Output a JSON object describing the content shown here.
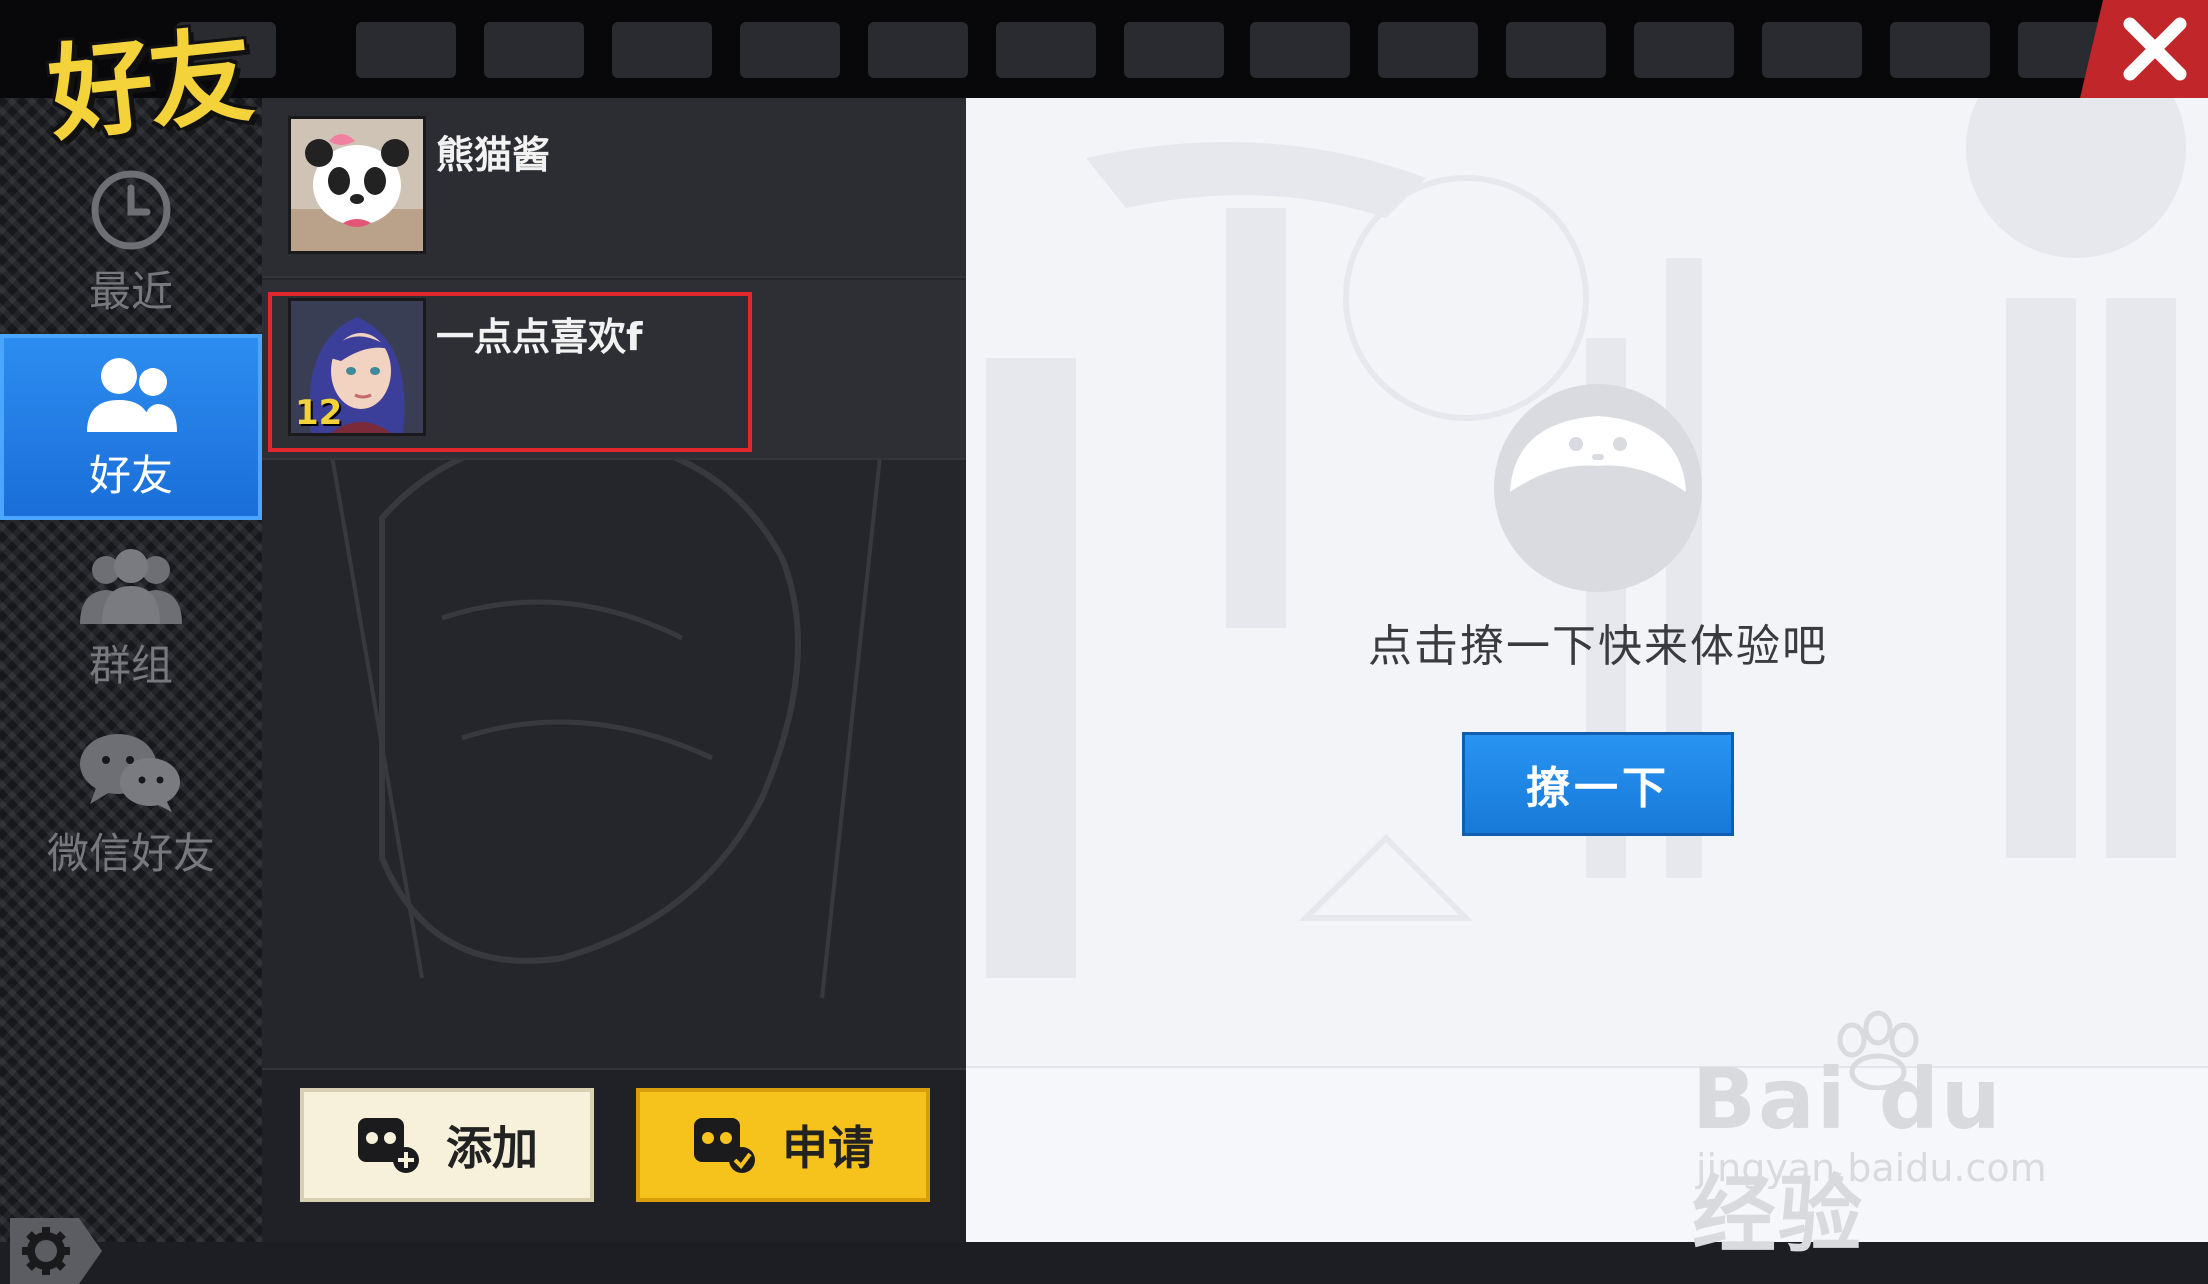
{
  "header": {
    "title": "好友",
    "close_icon": "close-icon",
    "accent_color": "#c0262a",
    "title_color": "#f4d23a"
  },
  "sidebar": {
    "items": [
      {
        "label": "最近",
        "icon": "clock-icon",
        "active": false
      },
      {
        "label": "好友",
        "icon": "friends-icon",
        "active": true
      },
      {
        "label": "群组",
        "icon": "group-icon",
        "active": false
      },
      {
        "label": "微信好友",
        "icon": "wechat-icon",
        "active": false
      }
    ],
    "settings_icon": "gear-icon",
    "active_color": "#2d8df0"
  },
  "friends": [
    {
      "name": "熊猫酱",
      "level": ""
    },
    {
      "name": "一点点喜欢f",
      "level": "12"
    }
  ],
  "actions": {
    "add_label": "添加",
    "apply_label": "申请"
  },
  "right": {
    "hint": "点击撩一下快来体验吧",
    "button_label": "撩一下"
  },
  "watermark": {
    "brand": "Bai du 经验",
    "url": "jingyan.baidu.com"
  }
}
